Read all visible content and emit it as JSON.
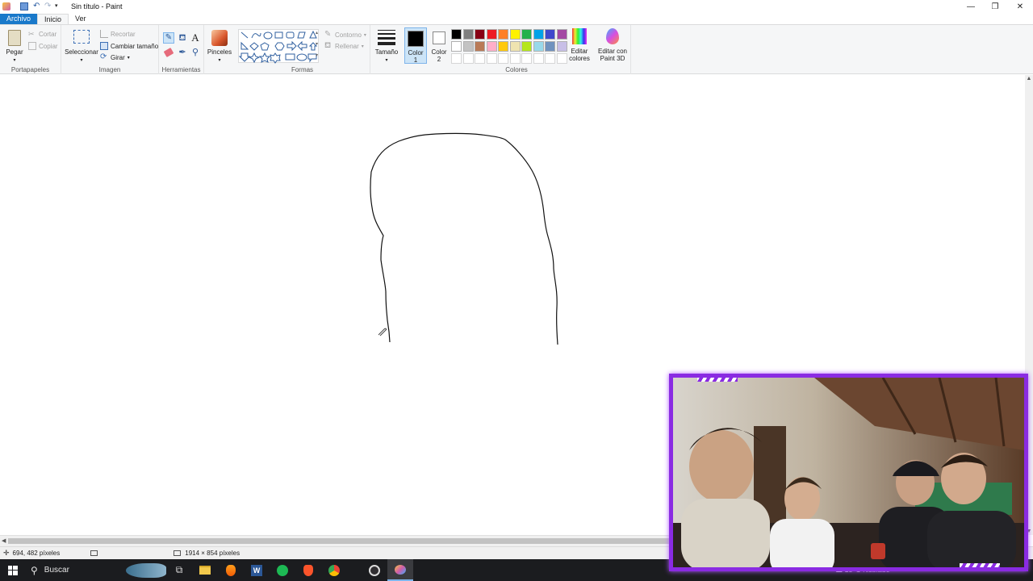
{
  "window": {
    "title": "Sin título - Paint",
    "controls": [
      "minimize-icon",
      "restore-icon",
      "close-icon"
    ]
  },
  "menu": {
    "file": "Archivo",
    "tabs": [
      "Inicio",
      "Ver"
    ],
    "active_tab": "Inicio"
  },
  "ribbon": {
    "clipboard": {
      "label": "Portapapeles",
      "paste": "Pegar",
      "cut": "Cortar",
      "copy": "Copiar"
    },
    "image": {
      "label": "Imagen",
      "select": "Seleccionar",
      "crop": "Recortar",
      "resize": "Cambiar tamaño",
      "rotate": "Girar"
    },
    "tools": {
      "label": "Herramientas",
      "items": [
        "pencil-icon",
        "fill-icon",
        "text-icon",
        "eraser-icon",
        "color-picker-icon",
        "magnifier-icon"
      ]
    },
    "brushes": {
      "label": "Pinceles"
    },
    "shapes": {
      "label": "Formas",
      "outline": "Contorno",
      "fill": "Rellenar"
    },
    "size": {
      "label": "Tamaño"
    },
    "colors": {
      "label": "Colores",
      "color1": "Color\n1",
      "color1_line1": "Color",
      "color1_line2": "1",
      "color2_line1": "Color",
      "color2_line2": "2",
      "edit_line1": "Editar",
      "edit_line2": "colores",
      "paint3d_line1": "Editar con",
      "paint3d_line2": "Paint 3D",
      "color1_value": "#000000",
      "color2_value": "#ffffff",
      "palette_row1": [
        "#000000",
        "#7f7f7f",
        "#880015",
        "#ed1c24",
        "#ff7f27",
        "#fff200",
        "#22b14c",
        "#00a2e8",
        "#3f48cc",
        "#a349a4"
      ],
      "palette_row2": [
        "#ffffff",
        "#c3c3c3",
        "#b97a57",
        "#ffaec9",
        "#ffc90e",
        "#efe4b0",
        "#b5e61d",
        "#99d9ea",
        "#7092be",
        "#c8bfe7"
      ]
    }
  },
  "status": {
    "cursor_pos": "694, 482 píxeles",
    "image_size": "1914 × 854 píxeles"
  },
  "taskbar": {
    "search": "Buscar",
    "apps": [
      "start-icon",
      "task-view-icon",
      "file-explorer-icon",
      "fl-studio-icon",
      "word-icon",
      "spotify-icon",
      "brave-icon",
      "chrome-icon",
      "obs-icon",
      "paint-icon"
    ],
    "weather": "15°C Nublado"
  }
}
